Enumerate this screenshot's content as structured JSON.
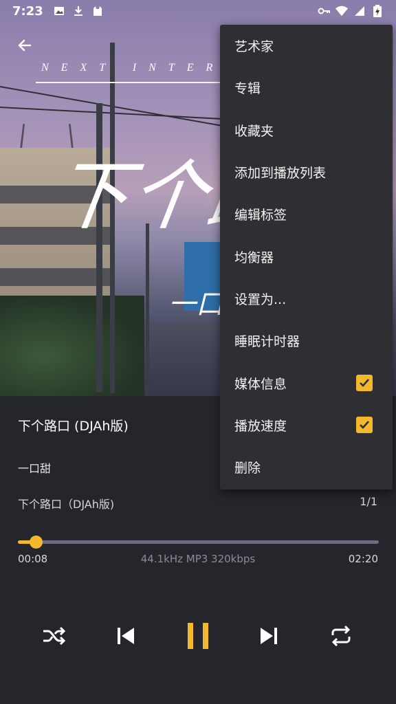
{
  "status_bar": {
    "time": "7:23",
    "left_icons": [
      "image-icon",
      "download-icon",
      "cat-icon"
    ],
    "right_icons": [
      "vpn-key-icon",
      "wifi-icon",
      "signal-icon",
      "battery-icon"
    ]
  },
  "album_art": {
    "banner_text": "NEXT INTER",
    "script_title": "下个路",
    "script_subtitle": "一口甜"
  },
  "player": {
    "song_title": "下个路口 (DJAh版)",
    "artist": "一口甜",
    "album": "下个路口（DJAh版)",
    "track_position": "1/1",
    "current_time": "00:08",
    "duration": "02:20",
    "audio_meta": "44.1kHz  MP3  320kbps",
    "progress_fraction": 0.05,
    "accent_color": "#f3b82c"
  },
  "menu": {
    "items": [
      {
        "label": "艺术家",
        "checked": null
      },
      {
        "label": "专辑",
        "checked": null
      },
      {
        "label": "收藏夹",
        "checked": null
      },
      {
        "label": "添加到播放列表",
        "checked": null
      },
      {
        "label": "编辑标签",
        "checked": null
      },
      {
        "label": "均衡器",
        "checked": null
      },
      {
        "label": "设置为...",
        "checked": null
      },
      {
        "label": "睡眠计时器",
        "checked": null
      },
      {
        "label": "媒体信息",
        "checked": true
      },
      {
        "label": "播放速度",
        "checked": true
      },
      {
        "label": "删除",
        "checked": null
      }
    ]
  },
  "controls": [
    "shuffle-icon",
    "previous-icon",
    "pause-icon",
    "next-icon",
    "repeat-icon"
  ]
}
